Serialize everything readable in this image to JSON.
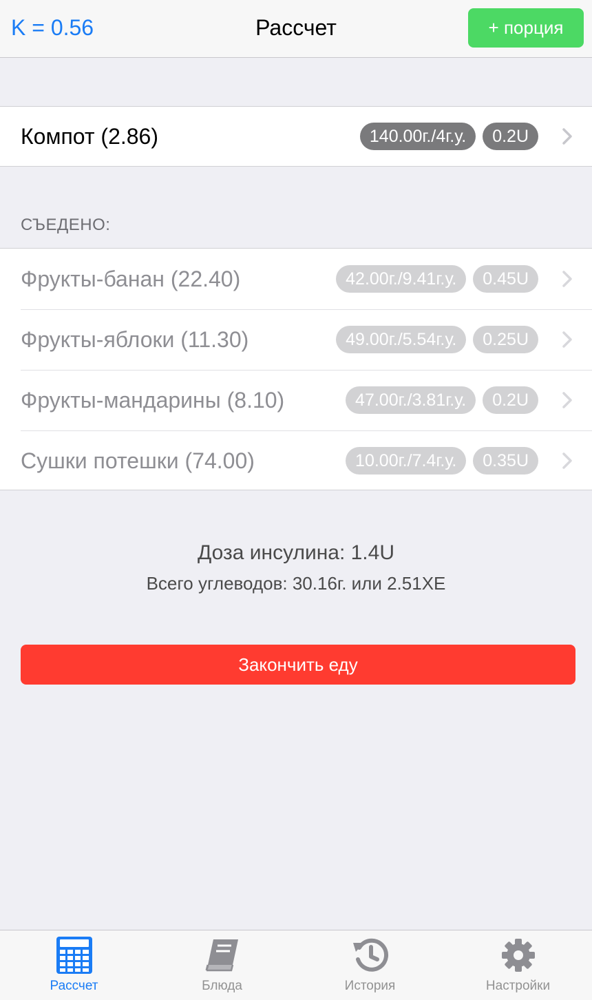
{
  "navbar": {
    "k_label": "K = 0.56",
    "title": "Рассчет",
    "add_portion_label": "+ порция"
  },
  "current": {
    "name": "Компот (2.86)",
    "weight_badge": "140.00г./4г.у.",
    "dose_badge": "0.2U"
  },
  "eaten": {
    "header": "СЪЕДЕНО:",
    "items": [
      {
        "name": "Фрукты-банан (22.40)",
        "weight_badge": "42.00г./9.41г.у.",
        "dose_badge": "0.45U"
      },
      {
        "name": "Фрукты-яблоки (11.30)",
        "weight_badge": "49.00г./5.54г.у.",
        "dose_badge": "0.25U"
      },
      {
        "name": "Фрукты-мандарины (8.10)",
        "weight_badge": "47.00г./3.81г.у.",
        "dose_badge": "0.2U"
      },
      {
        "name": "Сушки потешки (74.00)",
        "weight_badge": "10.00г./7.4г.у.",
        "dose_badge": "0.35U"
      }
    ]
  },
  "summary": {
    "dose": "Доза инсулина: 1.4U",
    "carbs": "Всего углеводов: 30.16г. или 2.51ХЕ"
  },
  "finish_button_label": "Закончить еду",
  "tabbar": {
    "tabs": [
      {
        "label": "Рассчет",
        "icon": "calculator-icon",
        "active": true
      },
      {
        "label": "Блюда",
        "icon": "book-icon",
        "active": false
      },
      {
        "label": "История",
        "icon": "history-icon",
        "active": false
      },
      {
        "label": "Настройки",
        "icon": "gear-icon",
        "active": false
      }
    ]
  },
  "colors": {
    "accent": "#1a7cf5",
    "add_button": "#4cd964",
    "finish_button": "#ff3b30",
    "background": "#efeff4"
  }
}
